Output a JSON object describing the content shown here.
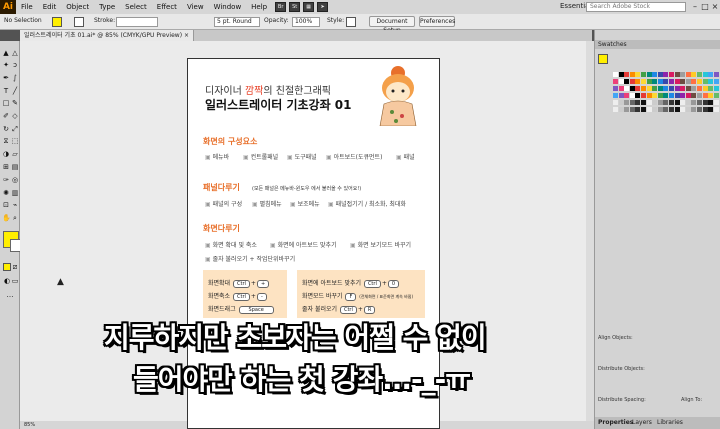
{
  "app": {
    "logo": "Ai",
    "menu": [
      "File",
      "Edit",
      "Object",
      "Type",
      "Select",
      "Effect",
      "View",
      "Window",
      "Help"
    ],
    "icons": [
      "Br",
      "St"
    ],
    "workspace": "Essentials",
    "search_placeholder": "Search Adobe Stock"
  },
  "control_bar": {
    "selection": "No Selection",
    "stroke_label": "Stroke:",
    "stroke_value": "",
    "brush": "5 pt. Round",
    "opacity_label": "Opacity:",
    "opacity_value": "100%",
    "style_label": "Style:",
    "doc_setup": "Document Setup",
    "preferences": "Preferences"
  },
  "document_tab": {
    "title": "일러스트레이터 기초 01.ai* @ 85% (CMYK/GPU Preview)",
    "close": "×"
  },
  "status": {
    "zoom": "85%"
  },
  "colors": {
    "fill": "#ffef00",
    "accent": "#e8702b",
    "highlight": "#e8452b",
    "box": "#fde3c2"
  },
  "artboard": {
    "title_line1_pre": "디자이너 ",
    "title_line1_hl": "깜짝",
    "title_line1_post": "의 친절한그래픽",
    "title_line2": "일러스트레이터 기초강좌 01",
    "sections": [
      {
        "title": "화면의 구성요소",
        "items": [
          "메뉴바",
          "컨트롤패널",
          "도구패널",
          "아트보드(도큐먼트)",
          "패널"
        ]
      },
      {
        "title": "패널다루기",
        "note": "(모든 패널은 메뉴바-윈도우 에서 불러올 수 있어요!)",
        "items": [
          "패널의 구성",
          "펼침메뉴",
          "보조메뉴",
          "패널접기기 / 최소화, 최대화"
        ]
      },
      {
        "title": "화면다루기",
        "items": [
          "화면 확대 및 축소",
          "화면에 아트보드 맞추기",
          "화면 보기모드 바꾸기",
          "줄자 불러오기 + 작업단위바꾸기"
        ]
      }
    ],
    "shortcuts_left": [
      {
        "label": "화면확대",
        "keys": [
          "Ctrl",
          "+",
          "+"
        ]
      },
      {
        "label": "화면축소",
        "keys": [
          "Ctrl",
          "+",
          "-"
        ]
      },
      {
        "label": "화면드래그",
        "keys": [
          "Space"
        ]
      }
    ],
    "shortcuts_right": [
      {
        "label": "화면에 아트보드 맞추기",
        "keys": [
          "Ctrl",
          "+",
          "0"
        ]
      },
      {
        "label": "화면모드 바꾸기",
        "keys": [
          "F"
        ],
        "note": "(전체화면 / 표준화면 계속 바뀜)"
      },
      {
        "label": "줄자 불러오기",
        "keys": [
          "Ctrl",
          "+",
          "R"
        ]
      }
    ]
  },
  "panel": {
    "swatches_title": "Swatches",
    "align_objects": "Align Objects:",
    "distribute_objects": "Distribute Objects:",
    "distribute_spacing": "Distribute Spacing:",
    "align_to": "Align To:",
    "tabs": [
      "Properties",
      "Layers",
      "Libraries"
    ]
  },
  "caption": {
    "line1": "지루하지만 초보자는 어쩔 수 없이",
    "line2": "들어야만 하는 첫 강좌...-_-ㅠ"
  }
}
